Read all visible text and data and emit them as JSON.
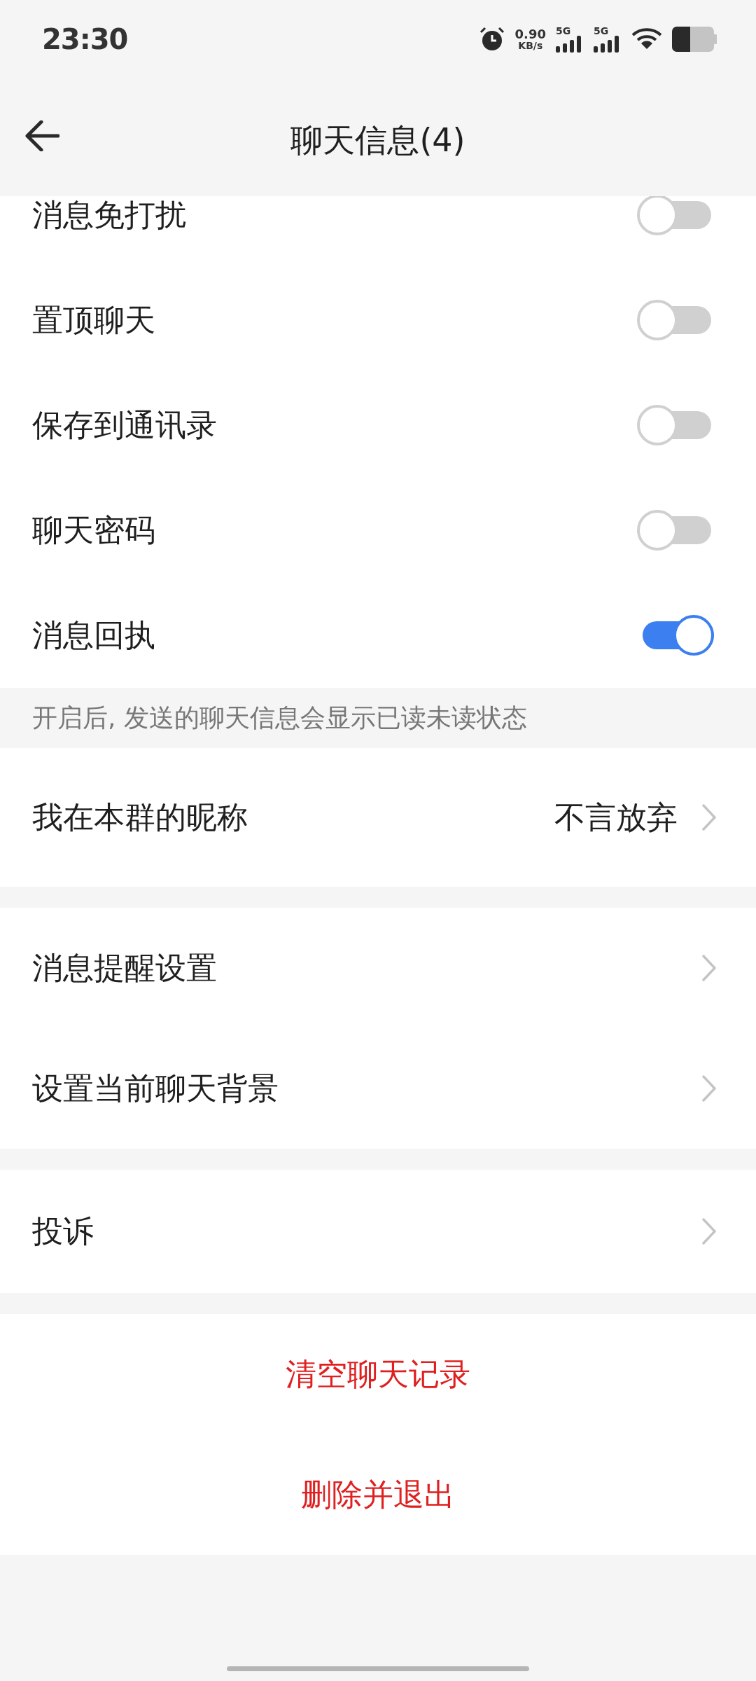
{
  "status_bar": {
    "time": "23:30",
    "speed_value": "0.90",
    "speed_unit": "KB/s",
    "sim_labels": [
      "5G",
      "5G"
    ]
  },
  "header": {
    "title": "聊天信息(4)"
  },
  "toggles": [
    {
      "label": "消息免打扰",
      "on": false
    },
    {
      "label": "置顶聊天",
      "on": false
    },
    {
      "label": "保存到通讯录",
      "on": false
    },
    {
      "label": "聊天密码",
      "on": false
    },
    {
      "label": "消息回执",
      "on": true
    }
  ],
  "toggle_note": "开启后, 发送的聊天信息会显示已读未读状态",
  "nickname": {
    "label": "我在本群的昵称",
    "value": "不言放弃"
  },
  "link_groups": [
    [
      "消息提醒设置",
      "设置当前聊天背景"
    ],
    [
      "投诉"
    ]
  ],
  "danger_actions": [
    "清空聊天记录",
    "删除并退出"
  ]
}
